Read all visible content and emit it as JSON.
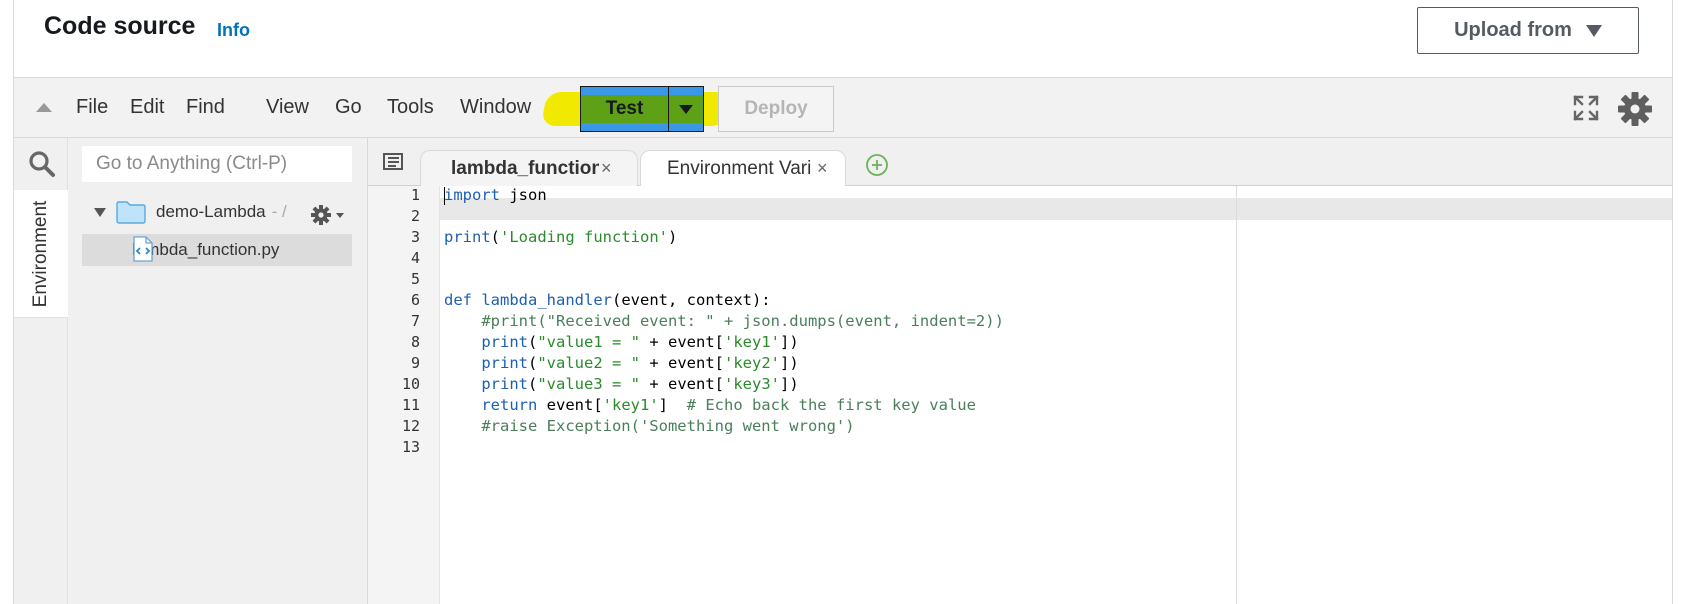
{
  "header": {
    "title": "Code source",
    "info_link": "Info",
    "upload_button": "Upload from"
  },
  "menubar": {
    "items": [
      "File",
      "Edit",
      "Find",
      "View",
      "Go",
      "Tools",
      "Window"
    ],
    "test_button": "Test",
    "deploy_button": "Deploy",
    "test_highlight_color": "#f1ea00"
  },
  "sidebar": {
    "rail_tab": "Environment",
    "goto_placeholder": "Go to Anything (Ctrl-P)",
    "tree_root": "demo-Lambda",
    "tree_root_sep": "- /",
    "tree_file": "lambda_function.py"
  },
  "tabs": [
    {
      "label": "lambda_function",
      "close": "×",
      "active": true
    },
    {
      "label": "Environment Vari",
      "close": "×",
      "active": false
    }
  ],
  "editor": {
    "line_numbers": [
      "1",
      "2",
      "3",
      "4",
      "5",
      "6",
      "7",
      "8",
      "9",
      "10",
      "11",
      "12",
      "13"
    ],
    "lines": [
      [
        [
          "kw",
          "import"
        ],
        [
          "",
          "  json"
        ]
      ],
      [],
      [
        [
          "kw",
          "print"
        ],
        [
          "",
          "("
        ],
        [
          "str",
          "'Loading function'"
        ],
        [
          "",
          ")"
        ]
      ],
      [],
      [],
      [
        [
          "kw",
          "def"
        ],
        [
          "",
          " "
        ],
        [
          "kw",
          "lambda_handler"
        ],
        [
          "",
          "(event, context):"
        ]
      ],
      [
        [
          "",
          "    "
        ],
        [
          "cmt",
          "#print(\"Received event: \" + json.dumps(event, indent=2))"
        ]
      ],
      [
        [
          "",
          "    "
        ],
        [
          "kw",
          "print"
        ],
        [
          "",
          "("
        ],
        [
          "str",
          "\"value1 = \""
        ],
        [
          "",
          " + event["
        ],
        [
          "str",
          "'key1'"
        ],
        [
          "",
          "])"
        ]
      ],
      [
        [
          "",
          "    "
        ],
        [
          "kw",
          "print"
        ],
        [
          "",
          "("
        ],
        [
          "str",
          "\"value2 = \""
        ],
        [
          "",
          " + event["
        ],
        [
          "str",
          "'key2'"
        ],
        [
          "",
          "])"
        ]
      ],
      [
        [
          "",
          "    "
        ],
        [
          "kw",
          "print"
        ],
        [
          "",
          "("
        ],
        [
          "str",
          "\"value3 = \""
        ],
        [
          "",
          " + event["
        ],
        [
          "str",
          "'key3'"
        ],
        [
          "",
          "])"
        ]
      ],
      [
        [
          "",
          "    "
        ],
        [
          "kw",
          "return"
        ],
        [
          "",
          " event["
        ],
        [
          "str",
          "'key1'"
        ],
        [
          "",
          "]  "
        ],
        [
          "cmt",
          "# Echo back the first key value"
        ]
      ],
      [
        [
          "",
          "    "
        ],
        [
          "cmt",
          "#raise Exception('Something went wrong')"
        ]
      ],
      []
    ]
  }
}
